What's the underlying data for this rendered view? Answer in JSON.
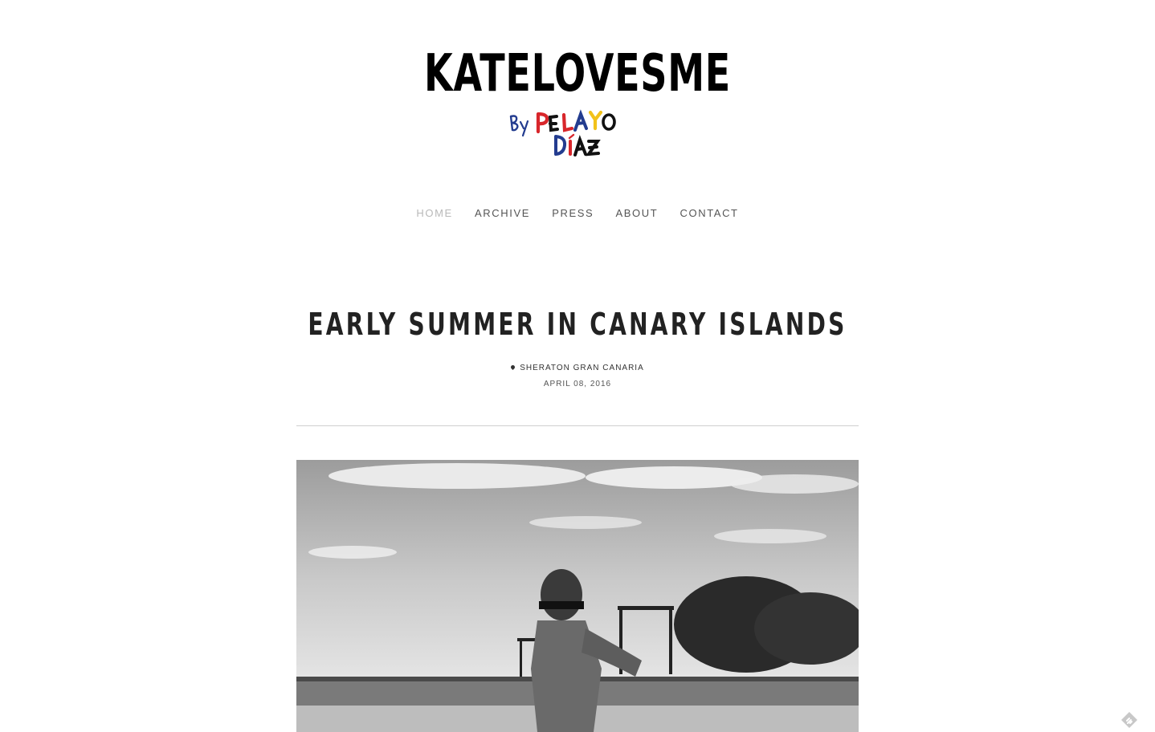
{
  "site": {
    "title": "KATELOVESME",
    "byline_image_text": "By Pelayo Díaz"
  },
  "nav": {
    "items": [
      {
        "label": "HOME",
        "active": true
      },
      {
        "label": "ARCHIVE",
        "active": false
      },
      {
        "label": "PRESS",
        "active": false
      },
      {
        "label": "ABOUT",
        "active": false
      },
      {
        "label": "CONTACT",
        "active": false
      }
    ]
  },
  "post": {
    "title": "EARLY SUMMER IN CANARY ISLANDS",
    "location": "SHERATON GRAN CANARIA",
    "date": "APRIL 08, 2016",
    "image_icon": "photo"
  },
  "widgets": {
    "feedly_icon": "feedly-icon"
  },
  "colors": {
    "nav_active": "#b9b9b9",
    "nav_default": "#555555",
    "signature_red": "#d8262b",
    "signature_blue": "#233c8f",
    "signature_yellow": "#f2c21a"
  }
}
